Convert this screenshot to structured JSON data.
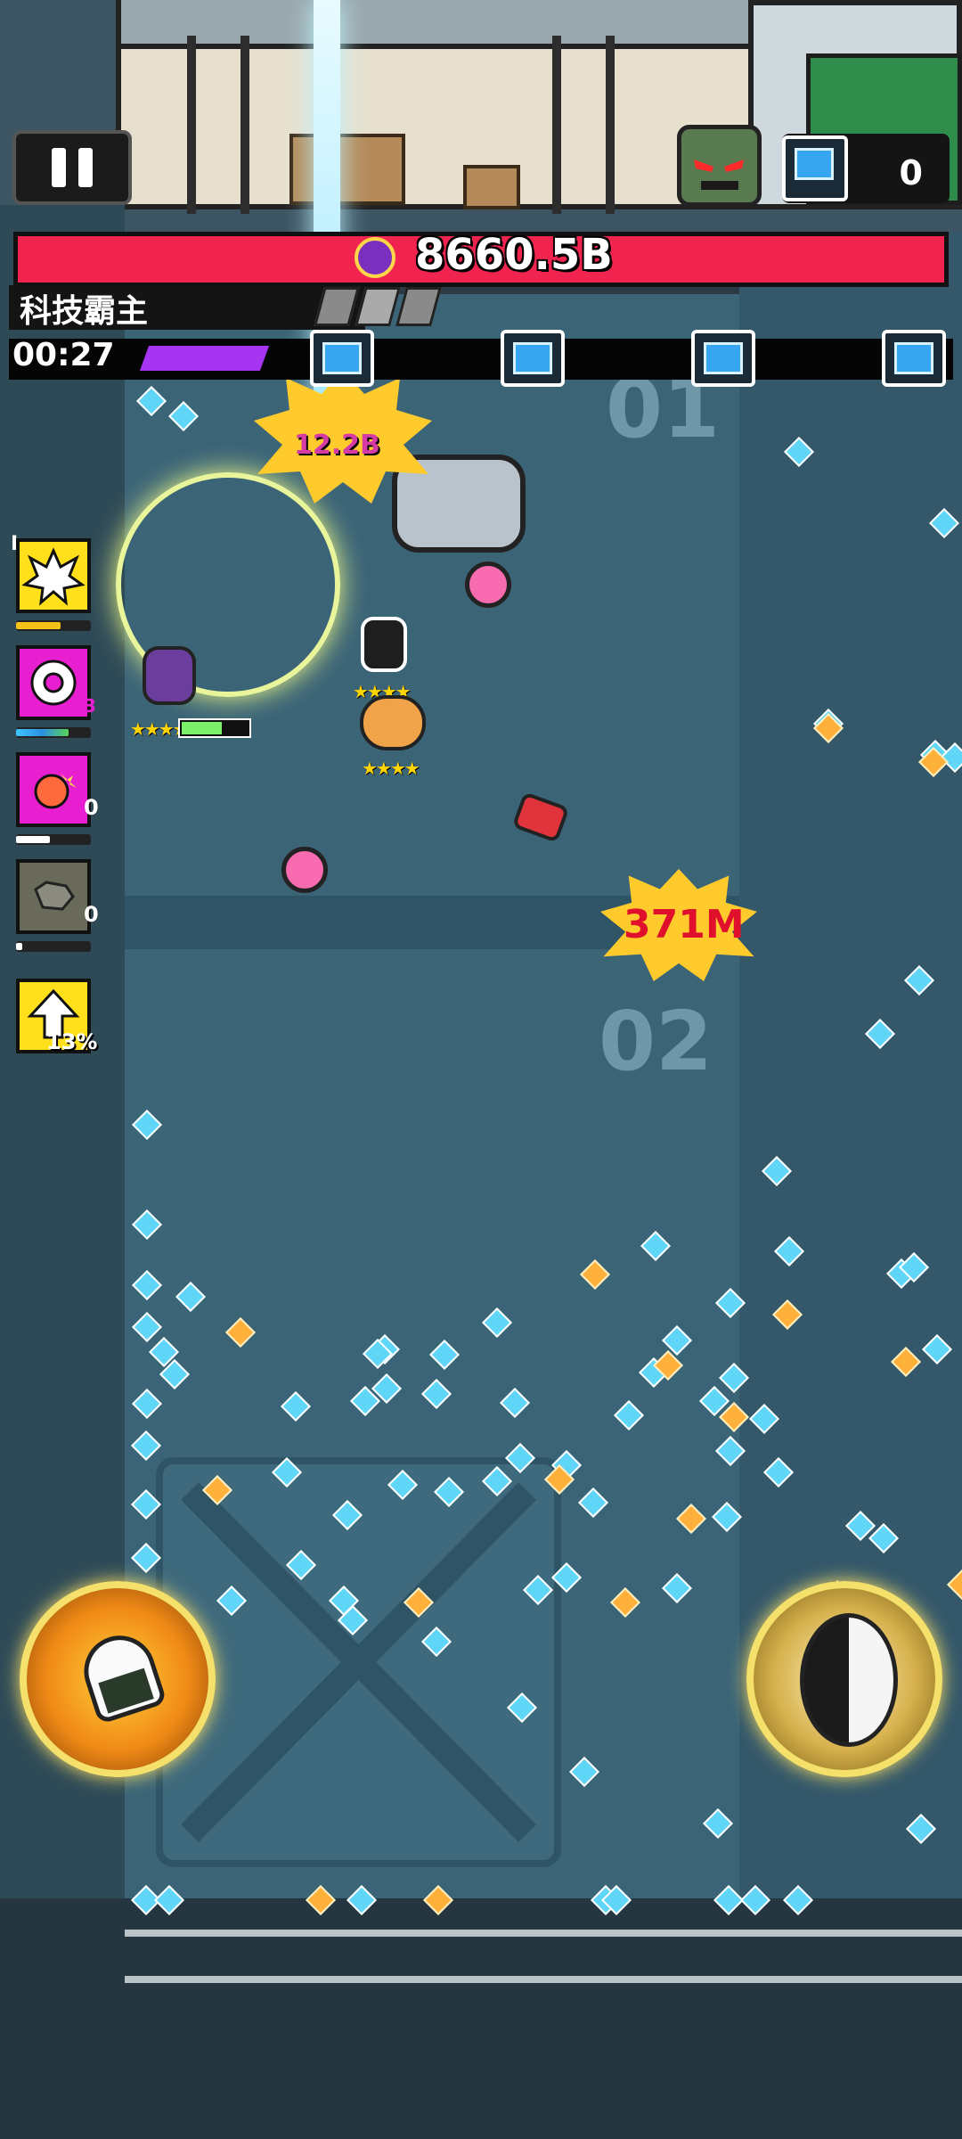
{
  "boss": {
    "hp_text": "8660.5B",
    "name": "科技霸主"
  },
  "hud": {
    "timer": "00:27",
    "chest_count": "0",
    "wave_progress": 0.15,
    "chest_markers": 4
  },
  "skills": [
    {
      "name": "explosion-skill",
      "count": "",
      "level_mark": "I"
    },
    {
      "name": "gear-skill",
      "count": "3"
    },
    {
      "name": "bomb-skill",
      "count": "0"
    },
    {
      "name": "dog-skill-locked",
      "count": "0"
    }
  ],
  "level_up": {
    "percent": "13%"
  },
  "damage_popups": {
    "large": "371M",
    "boss_hit": "12.2B"
  },
  "floor_labels": [
    "01",
    "02"
  ],
  "colors": {
    "boss_hp": "#f0244f",
    "wave_progress": "#a535f0",
    "skill_magenta": "#e81fd0",
    "skill_yellow": "#ffe01a"
  }
}
